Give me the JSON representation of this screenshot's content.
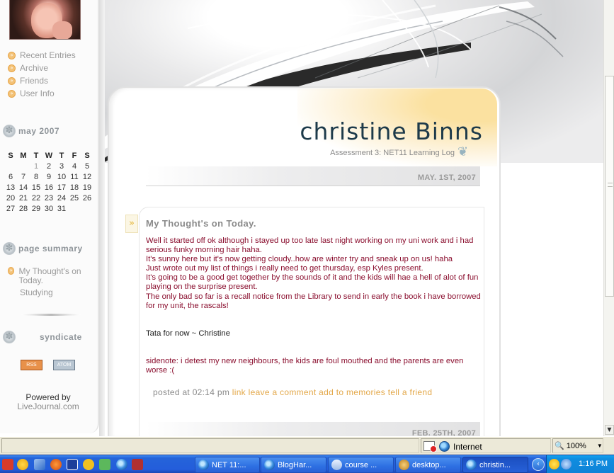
{
  "sidebar": {
    "nav": [
      {
        "label": "Recent Entries"
      },
      {
        "label": "Archive"
      },
      {
        "label": "Friends"
      },
      {
        "label": "User Info"
      }
    ],
    "calendar": {
      "title": "may 2007",
      "weekdays": [
        "S",
        "M",
        "T",
        "W",
        "T",
        "F",
        "S"
      ],
      "weeks": [
        [
          "",
          "",
          "1",
          "2",
          "3",
          "4",
          "5"
        ],
        [
          "6",
          "7",
          "8",
          "9",
          "10",
          "11",
          "12"
        ],
        [
          "13",
          "14",
          "15",
          "16",
          "17",
          "18",
          "19"
        ],
        [
          "20",
          "21",
          "22",
          "23",
          "24",
          "25",
          "26"
        ],
        [
          "27",
          "28",
          "29",
          "30",
          "31",
          "",
          ""
        ]
      ],
      "dimmed_day": "1"
    },
    "summary": {
      "title": "page summary",
      "items": [
        "My Thought's on Today.",
        "Studying"
      ]
    },
    "syndicate": {
      "title": "syndicate",
      "rss": "RSS",
      "atom": "ATOM"
    },
    "powered_by": "Powered by",
    "powered_link": "LiveJournal.com"
  },
  "journal": {
    "title": "christine Binns",
    "subtitle": "Assessment 3: NET11 Learning Log"
  },
  "entries": [
    {
      "date": "MAY. 1ST, 2007",
      "subject": "My Thought's on Today.",
      "paragraphs": [
        "Well it started off ok although i stayed up too late last night working on my uni work and i had serious funky morning hair haha.",
        "It's sunny here but it's now getting cloudy..how are winter try and sneak up on us! haha",
        "Just wrote out my list of things i really need to get thursday, esp Kyles present.",
        "It's going to be a good get together by the sounds of it and the kids will hae a hell of alot of fun playing on the surprise present.",
        "The only bad so far is a recall notice from the Library to send in early the book i have borrowed for my unit, the rascals!"
      ],
      "signoff": "Tata for now ~ Christine",
      "sidenote": "sidenote: i detest my new neighbours, the kids are foul mouthed and the parents are even worse :(",
      "posted_at": "posted at 02:14 pm",
      "links": [
        "link",
        "leave a comment",
        "add to memories",
        "tell a friend"
      ]
    },
    {
      "date": "FEB. 25TH, 2007"
    }
  ],
  "statusbar": {
    "zone": "Internet",
    "zoom": "100%"
  },
  "taskbar": {
    "tasks": [
      {
        "label": "NET 11:..."
      },
      {
        "label": "BlogHar..."
      },
      {
        "label": "course ..."
      },
      {
        "label": "desktop..."
      },
      {
        "label": "christin..."
      }
    ],
    "clock": "1:16 PM"
  },
  "colors": {
    "accent_orange": "#e3a84a",
    "entry_text": "#8a0e2e",
    "title_text": "#1d3a4a",
    "taskbar_blue": "#245ddb"
  }
}
